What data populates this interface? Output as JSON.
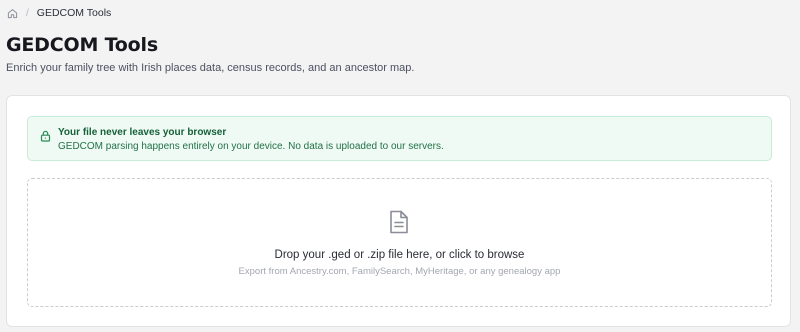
{
  "breadcrumb": {
    "home_icon": "home-icon",
    "separator": "/",
    "current": "GEDCOM Tools"
  },
  "header": {
    "title": "GEDCOM Tools",
    "subtitle": "Enrich your family tree with Irish places data, census records, and an ancestor map."
  },
  "privacy_notice": {
    "icon": "lock-icon",
    "title": "Your file never leaves your browser",
    "body": "GEDCOM parsing happens entirely on your device. No data is uploaded to our servers.",
    "colors": {
      "background": "#eefaf3",
      "border": "#c9ecd8",
      "text": "#17603a"
    }
  },
  "dropzone": {
    "icon": "file-text-icon",
    "title": "Drop your .ged or .zip file here, or click to browse",
    "hint": "Export from Ancestry.com, FamilySearch, MyHeritage, or any genealogy app"
  }
}
